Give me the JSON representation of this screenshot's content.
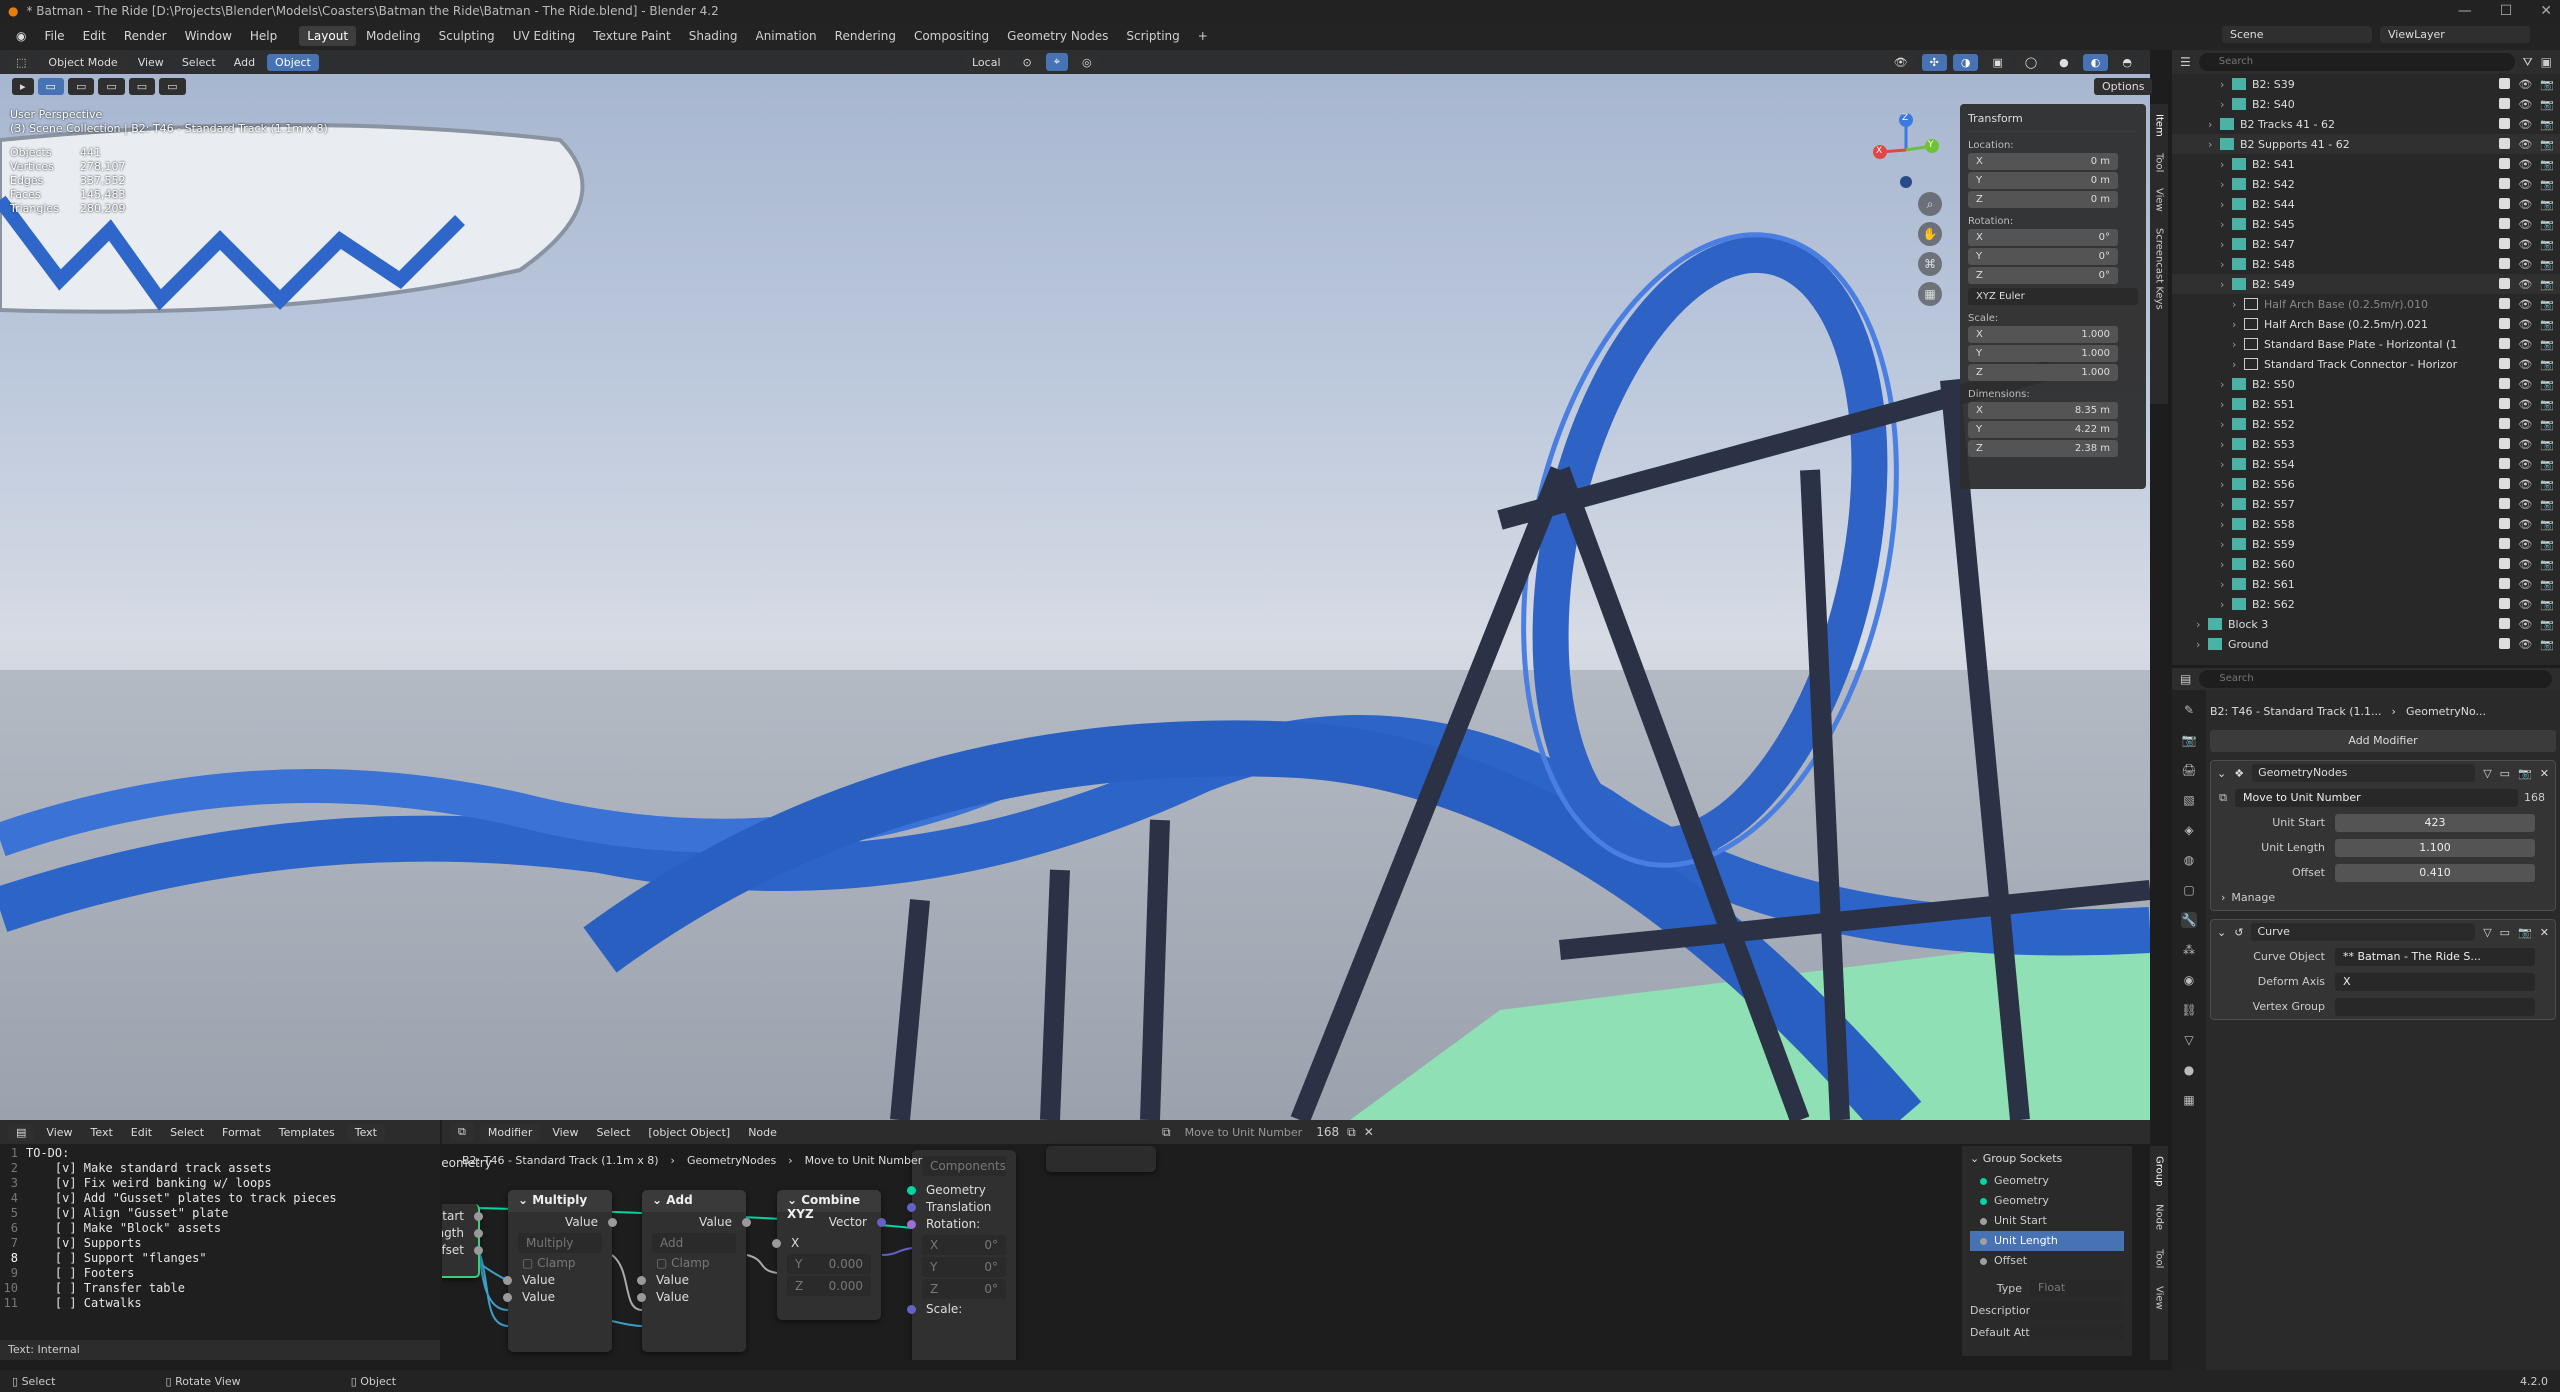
{
  "window": {
    "title": "* Batman - The Ride [D:\\Projects\\Blender\\Models\\Coasters\\Batman the Ride\\Batman - The Ride.blend] - Blender 4.2"
  },
  "menu": [
    "File",
    "Edit",
    "Render",
    "Window",
    "Help"
  ],
  "workspaces": [
    "Layout",
    "Modeling",
    "Sculpting",
    "UV Editing",
    "Texture Paint",
    "Shading",
    "Animation",
    "Rendering",
    "Compositing",
    "Geometry Nodes",
    "Scripting"
  ],
  "active_workspace": "Layout",
  "scene": {
    "label": "Scene",
    "viewlayer": "ViewLayer"
  },
  "viewport": {
    "mode": "Object Mode",
    "view": "View",
    "select": "Select",
    "add": "Add",
    "object": "Object",
    "transform_orientation": "Local",
    "options": "Options",
    "overlay_title": "User Perspective",
    "overlay_sub": "(3) Scene Collection | B2: T46 - Standard Track (1.1m x 8)",
    "stats": [
      {
        "k": "Objects",
        "v": "441"
      },
      {
        "k": "Vertices",
        "v": "278,107"
      },
      {
        "k": "Edges",
        "v": "337,552"
      },
      {
        "k": "Faces",
        "v": "145,483"
      },
      {
        "k": "Triangles",
        "v": "280,209"
      }
    ],
    "gizmo": {
      "x": "X",
      "y": "Y",
      "z": "Z"
    }
  },
  "npanel": {
    "title": "Transform",
    "location_label": "Location:",
    "location": [
      {
        "a": "X",
        "v": "0 m"
      },
      {
        "a": "Y",
        "v": "0 m"
      },
      {
        "a": "Z",
        "v": "0 m"
      }
    ],
    "rotation_label": "Rotation:",
    "rotation": [
      {
        "a": "X",
        "v": "0°"
      },
      {
        "a": "Y",
        "v": "0°"
      },
      {
        "a": "Z",
        "v": "0°"
      }
    ],
    "rotation_mode": "XYZ Euler",
    "scale_label": "Scale:",
    "scale": [
      {
        "a": "X",
        "v": "1.000"
      },
      {
        "a": "Y",
        "v": "1.000"
      },
      {
        "a": "Z",
        "v": "1.000"
      }
    ],
    "dimensions_label": "Dimensions:",
    "dimensions": [
      {
        "a": "X",
        "v": "8.35 m"
      },
      {
        "a": "Y",
        "v": "4.22 m"
      },
      {
        "a": "Z",
        "v": "2.38 m"
      }
    ],
    "tabs": [
      "Item",
      "Tool",
      "View",
      "Screencast Keys"
    ]
  },
  "outliner": {
    "search_placeholder": "Search",
    "rows": [
      {
        "label": "B2: S39",
        "indent": 4
      },
      {
        "label": "B2: S40",
        "indent": 4
      },
      {
        "label": "B2 Tracks 41 - 62",
        "indent": 3
      },
      {
        "label": "B2 Supports 41 - 62",
        "indent": 3
      },
      {
        "label": "B2: S41",
        "indent": 4
      },
      {
        "label": "B2: S42",
        "indent": 4
      },
      {
        "label": "B2: S44",
        "indent": 4
      },
      {
        "label": "B2: S45",
        "indent": 4
      },
      {
        "label": "B2: S47",
        "indent": 4
      },
      {
        "label": "B2: S48",
        "indent": 4
      },
      {
        "label": "B2: S49",
        "indent": 4
      },
      {
        "label": "Half Arch Base (0.2.5m/r).010",
        "indent": 5,
        "dim": true
      },
      {
        "label": "Half Arch Base (0.2.5m/r).021",
        "indent": 5
      },
      {
        "label": "Standard Base Plate - Horizontal (1",
        "indent": 5
      },
      {
        "label": "Standard Track Connector - Horizor",
        "indent": 5
      },
      {
        "label": "B2: S50",
        "indent": 4
      },
      {
        "label": "B2: S51",
        "indent": 4
      },
      {
        "label": "B2: S52",
        "indent": 4
      },
      {
        "label": "B2: S53",
        "indent": 4
      },
      {
        "label": "B2: S54",
        "indent": 4
      },
      {
        "label": "B2: S56",
        "indent": 4
      },
      {
        "label": "B2: S57",
        "indent": 4
      },
      {
        "label": "B2: S58",
        "indent": 4
      },
      {
        "label": "B2: S59",
        "indent": 4
      },
      {
        "label": "B2: S60",
        "indent": 4
      },
      {
        "label": "B2: S61",
        "indent": 4
      },
      {
        "label": "B2: S62",
        "indent": 4
      },
      {
        "label": "Block 3",
        "indent": 2
      },
      {
        "label": "Ground",
        "indent": 2
      }
    ]
  },
  "properties": {
    "search_placeholder": "Search",
    "breadcrumb_obj": "B2: T46 - Standard Track (1.1...",
    "breadcrumb_mod": "GeometryNo...",
    "add_modifier": "Add Modifier",
    "geonodes": {
      "name": "GeometryNodes",
      "nodegroup": "Move to Unit Number",
      "users": "168",
      "fields": [
        {
          "l": "Unit Start",
          "v": "423"
        },
        {
          "l": "Unit Length",
          "v": "1.100"
        },
        {
          "l": "Offset",
          "v": "0.410"
        }
      ],
      "manage": "Manage"
    },
    "curve": {
      "name": "Curve",
      "curve_object_label": "Curve Object",
      "curve_object": "** Batman - The Ride S...",
      "deform_axis_label": "Deform Axis",
      "deform_axis": "X",
      "vertex_group_label": "Vertex Group"
    }
  },
  "text_editor": {
    "view": "View",
    "text": "Text",
    "edit": "Edit",
    "select": "Select",
    "format": "Format",
    "templates": "Templates",
    "name": "Text",
    "lines": [
      {
        "n": "1",
        "t": "TO-DO:"
      },
      {
        "n": "2",
        "t": "    [v] Make standard track assets"
      },
      {
        "n": "3",
        "t": "    [v] Fix weird banking w/ loops"
      },
      {
        "n": "4",
        "t": "    [v] Add \"Gusset\" plates to track pieces"
      },
      {
        "n": "5",
        "t": "    [v] Align \"Gusset\" plate"
      },
      {
        "n": "6",
        "t": "    [ ] Make \"Block\" assets"
      },
      {
        "n": "7",
        "t": "    [v] Supports"
      },
      {
        "n": "8",
        "t": "    [ ] Support \"flanges\""
      },
      {
        "n": "9",
        "t": "    [ ] Footers"
      },
      {
        "n": "10",
        "t": "    [ ] Transfer table"
      },
      {
        "n": "11",
        "t": "    [ ] Catwalks"
      }
    ],
    "footer": "Text: Internal"
  },
  "node_editor": {
    "modifier": "Modifier",
    "view": "View",
    "select": "Select",
    "add": {
      "title": "Add",
      "value_out": "Value",
      "op": "Add",
      "clamp": "Clamp",
      "in1": "Value",
      "in2": "Value"
    },
    "node": "Node",
    "group": "Move to Unit Number",
    "users": "168",
    "breadcrumb": [
      "B2: T46 - Standard Track (1.1m x 8)",
      "GeometryNodes",
      "Move to Unit Number"
    ],
    "group_input": {
      "geometry": "Geometry",
      "unit_start": "Unit Start",
      "unit_length": "Unit Length",
      "offset": "Offset"
    },
    "multiply": {
      "title": "Multiply",
      "value_out": "Value",
      "op": "Multiply",
      "clamp": "Clamp",
      "in1": "Value",
      "in2": "Value"
    },
    "combine": {
      "title": "Combine XYZ",
      "vector": "Vector",
      "x": "X",
      "y": "Y",
      "yv": "0.000",
      "z": "Z",
      "zv": "0.000"
    },
    "transform": {
      "components": "Components",
      "geometry": "Geometry",
      "translation": "Translation",
      "rotation": "Rotation:",
      "rx": "X",
      "rxv": "0°",
      "ry": "Y",
      "ryv": "0°",
      "rz": "Z",
      "rzv": "0°",
      "scale": "Scale:"
    },
    "group_sockets": {
      "title": "Group Sockets",
      "items": [
        "Geometry",
        "Geometry",
        "Unit Start",
        "Unit Length",
        "Offset"
      ],
      "type_label": "Type",
      "type_value": "Float",
      "desc_label": "Description",
      "default_label": "Default Att..."
    },
    "tabs": [
      "Group",
      "Node",
      "Tool",
      "View"
    ]
  },
  "status": {
    "select": "Select",
    "rotate": "Rotate View",
    "object": "Object",
    "version": "4.2.0"
  }
}
